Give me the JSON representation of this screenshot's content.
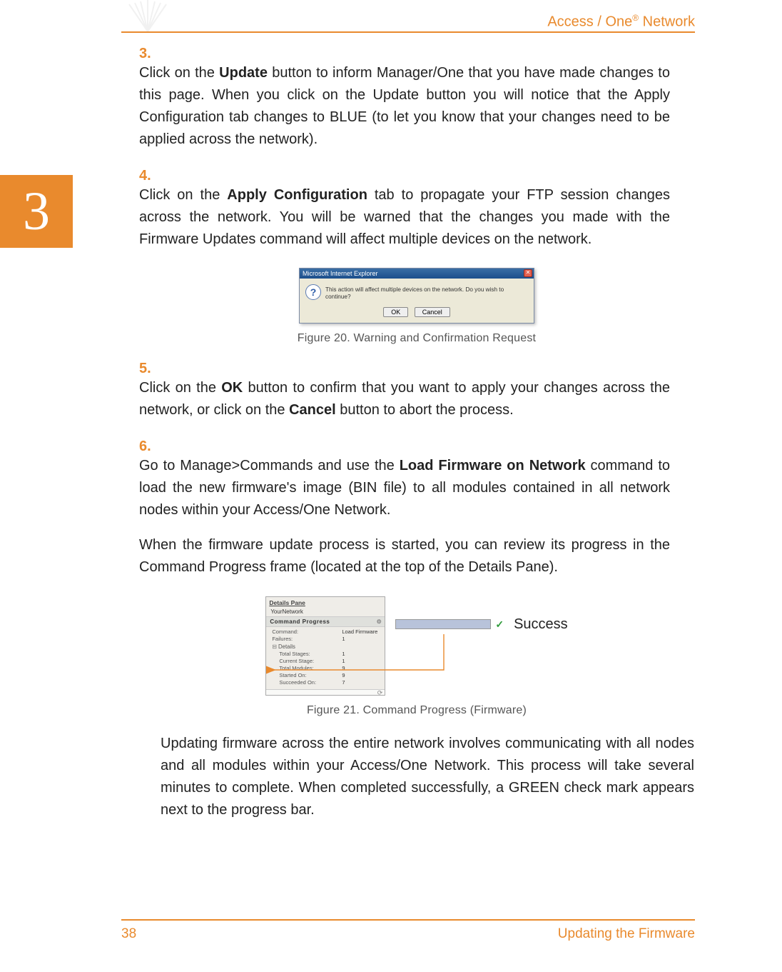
{
  "header": {
    "brand_pre": "Access / One",
    "brand_sup": "®",
    "brand_post": " Network"
  },
  "chapter": "3",
  "steps": {
    "s3": {
      "num": "3.",
      "text": "Click on the <b>Update</b> button to inform Manager/One that you have made changes to this page. When you click on the Update button you will notice that the Apply Configuration tab changes to BLUE (to let you know that your changes need to be applied across the network)."
    },
    "s4": {
      "num": "4.",
      "text": "Click on the <b>Apply Configuration</b> tab to propagate your FTP session changes across the network. You will be warned that the changes you made with the Firmware Updates command will affect multiple devices on the network."
    },
    "s5": {
      "num": "5.",
      "text": "Click on the <b>OK</b> button to confirm that you want to apply your changes across the network, or click on the <b>Cancel</b> button to abort the process."
    },
    "s6": {
      "num": "6.",
      "text": "Go to Manage>Commands and use the <b>Load Firmware on Network</b> command to load the new firmware's image (BIN file) to all modules contained in all network nodes within your Access/One Network.",
      "para2": "When the firmware update process is started, you can review its progress in the Command Progress frame (located at the top of the Details Pane)."
    }
  },
  "ie_dialog": {
    "title": "Microsoft Internet Explorer",
    "message": "This action will affect multiple devices on the network. Do you wish to continue?",
    "ok": "OK",
    "cancel": "Cancel"
  },
  "fig20": "Figure 20. Warning and Confirmation Request",
  "details_pane": {
    "title": "Details Pane",
    "network": "YourNetwork",
    "section": "Command Progress",
    "rows": {
      "command_k": "Command:",
      "command_v": "Load Firmware",
      "failures_k": "Failures:",
      "failures_v": "1",
      "details_hdr": "Details",
      "totstages_k": "Total Stages:",
      "totstages_v": "1",
      "curstage_k": "Current Stage:",
      "curstage_v": "1",
      "totmodules_k": "Total Modules:",
      "totmodules_v": "9",
      "started_k": "Started On:",
      "started_v": "9",
      "succeeded_k": "Succeeded On:",
      "succeeded_v": "7"
    }
  },
  "success_label": "Success",
  "fig21": "Figure 21. Command Progress (Firmware)",
  "closing_para": "Updating firmware across the entire network involves communicating with all nodes and all modules within your Access/One Network. This process will take several minutes to complete. When completed successfully, a GREEN check mark appears next to the progress bar.",
  "footer": {
    "page": "38",
    "section": "Updating the Firmware"
  }
}
